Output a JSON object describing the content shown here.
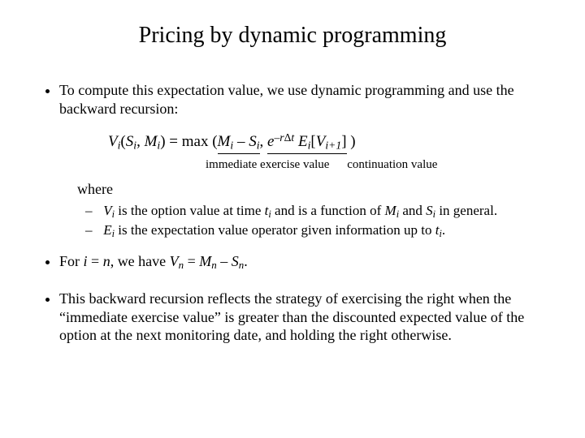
{
  "title": "Pricing by dynamic programming",
  "bullet1": "To compute this expectation value, we use dynamic programming and use the backward recursion:",
  "formula": {
    "lhs_V": "V",
    "lhs_i1": "i",
    "open_paren": "(",
    "S": "S",
    "sub_i2": "i",
    "comma1": ", ",
    "M": "M",
    "sub_i3": "i",
    "close_paren_eq": ") = max (",
    "M2": "M",
    "sub_i4": "i",
    "minus": " – ",
    "S2": "S",
    "sub_i5": "i",
    "comma2": ", ",
    "e": "e",
    "sup_minus": "–",
    "sup_r": "r",
    "sup_delta": "Δ",
    "sup_t": "t",
    "space": " ",
    "E": "E",
    "sub_i6": "i",
    "bracket_open": "[",
    "V2": "V",
    "sub_i_plus1": "i+1",
    "bracket_close": "]",
    "end_paren": " )"
  },
  "label_immediate": "immediate exercise value",
  "label_continuation": "continuation value",
  "where": "where",
  "sub1_before": "V",
  "sub1_i": "i",
  "sub1_mid1": " is the option value at time ",
  "sub1_t": "t",
  "sub1_ti": "i",
  "sub1_mid2": " and is a function of ",
  "sub1_M": "M",
  "sub1_Mi": "i",
  "sub1_and": " and ",
  "sub1_S": "S",
  "sub1_Si": "i",
  "sub1_end": " in general.",
  "sub2_E": "E",
  "sub2_Ei": "i",
  "sub2_mid": " is the expectation value operator given information up to ",
  "sub2_t": "t",
  "sub2_ti": "i",
  "sub2_end": ".",
  "bullet2_a": "For ",
  "bullet2_i": "i",
  "bullet2_eq": " = ",
  "bullet2_n": "n",
  "bullet2_have": ", we have ",
  "bullet2_V": "V",
  "bullet2_Vn": "n",
  "bullet2_eq2": " = ",
  "bullet2_M": "M",
  "bullet2_Mn": "n",
  "bullet2_minus": " – ",
  "bullet2_S": "S",
  "bullet2_Sn": "n",
  "bullet2_dot": ".",
  "bullet3": "This backward recursion reflects the strategy of exercising the right when the “immediate exercise value” is greater than the discounted expected value of the option at the next monitoring date, and holding the right otherwise."
}
